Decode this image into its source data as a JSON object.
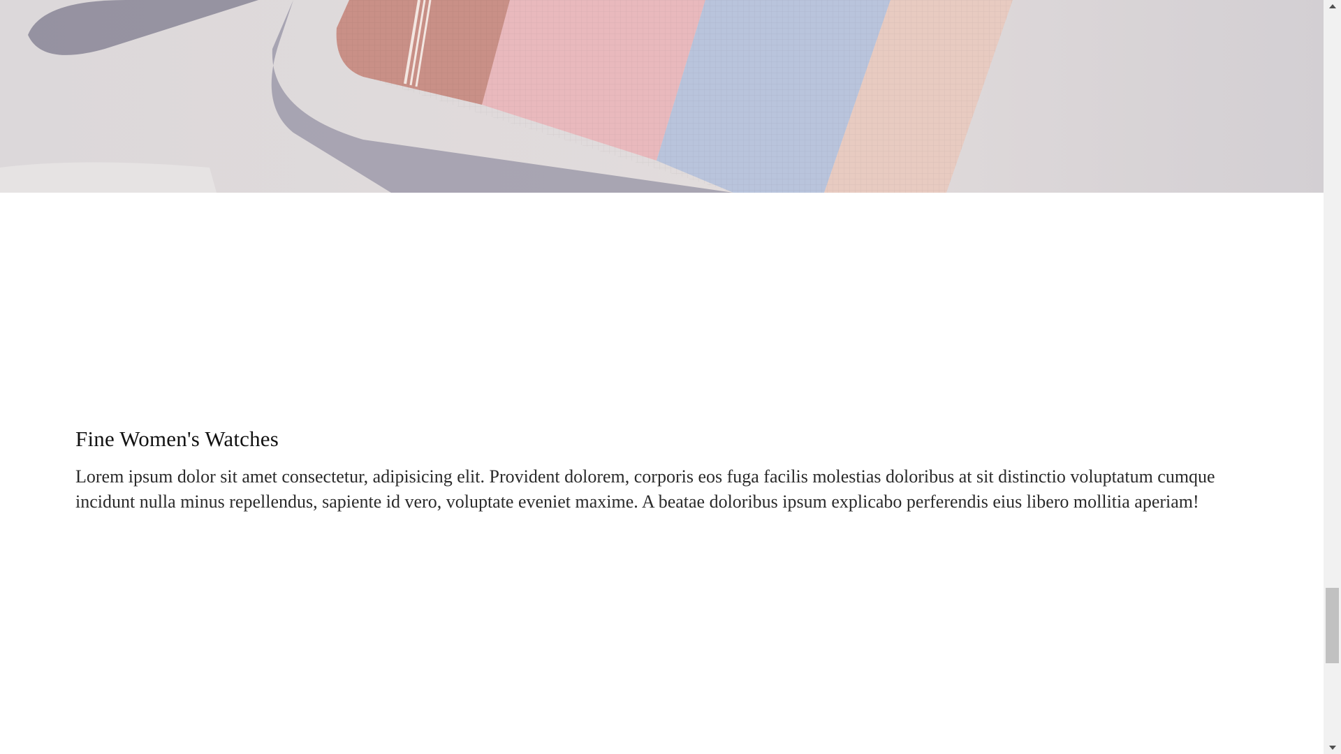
{
  "section": {
    "heading": "Fine Women's Watches",
    "paragraph": "Lorem ipsum dolor sit amet consectetur, adipisicing elit. Provident dolorem, corporis eos fuga facilis molestias doloribus at sit distinctio voluptatum cumque incidunt nulla minus repellendus, sapiente id vero, voluptate eveniet maxime. A beatae doloribus ipsum explicabo perferendis eius libero mollitia aperiam!"
  },
  "colors": {
    "page_background": "#ffffff",
    "heading_text": "#111111",
    "body_text": "#2a2a2a",
    "scrollbar_track": "#f1f1f1",
    "scrollbar_thumb": "#c1c1c1"
  },
  "icons": {
    "scroll_up": "triangle-up-icon",
    "scroll_down": "triangle-down-icon"
  }
}
